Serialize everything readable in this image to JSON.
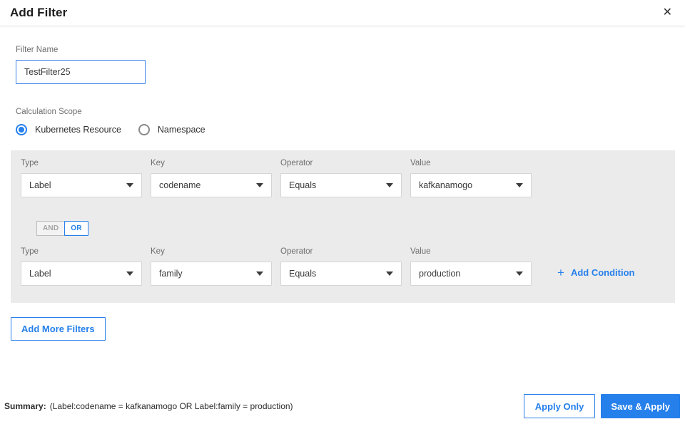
{
  "colors": {
    "accent": "#2680eb",
    "panel_bg": "#ebebeb"
  },
  "header": {
    "title": "Add Filter",
    "close_icon": "✕"
  },
  "filter_name": {
    "label": "Filter Name",
    "value": "TestFilter25"
  },
  "calculation_scope": {
    "label": "Calculation Scope",
    "options": [
      {
        "label": "Kubernetes Resource",
        "selected": true
      },
      {
        "label": "Namespace",
        "selected": false
      }
    ]
  },
  "conditions": {
    "logic_toggle": {
      "and_label": "AND",
      "or_label": "OR",
      "selected": "OR"
    },
    "add_condition": {
      "icon": "+",
      "label": "Add Condition"
    },
    "rows": [
      {
        "type": {
          "label": "Type",
          "value": "Label"
        },
        "key": {
          "label": "Key",
          "value": "codename"
        },
        "operator": {
          "label": "Operator",
          "value": "Equals"
        },
        "value": {
          "label": "Value",
          "value": "kafkanamogo"
        }
      },
      {
        "type": {
          "label": "Type",
          "value": "Label"
        },
        "key": {
          "label": "Key",
          "value": "family"
        },
        "operator": {
          "label": "Operator",
          "value": "Equals"
        },
        "value": {
          "label": "Value",
          "value": "production"
        }
      }
    ]
  },
  "add_more_filters": {
    "label": "Add More Filters"
  },
  "footer": {
    "summary_label": "Summary:",
    "summary_text": "(Label:codename = kafkanamogo OR Label:family = production)",
    "buttons": [
      {
        "label": "Apply Only",
        "style": "outline"
      },
      {
        "label": "Save & Apply",
        "style": "filled"
      }
    ]
  }
}
